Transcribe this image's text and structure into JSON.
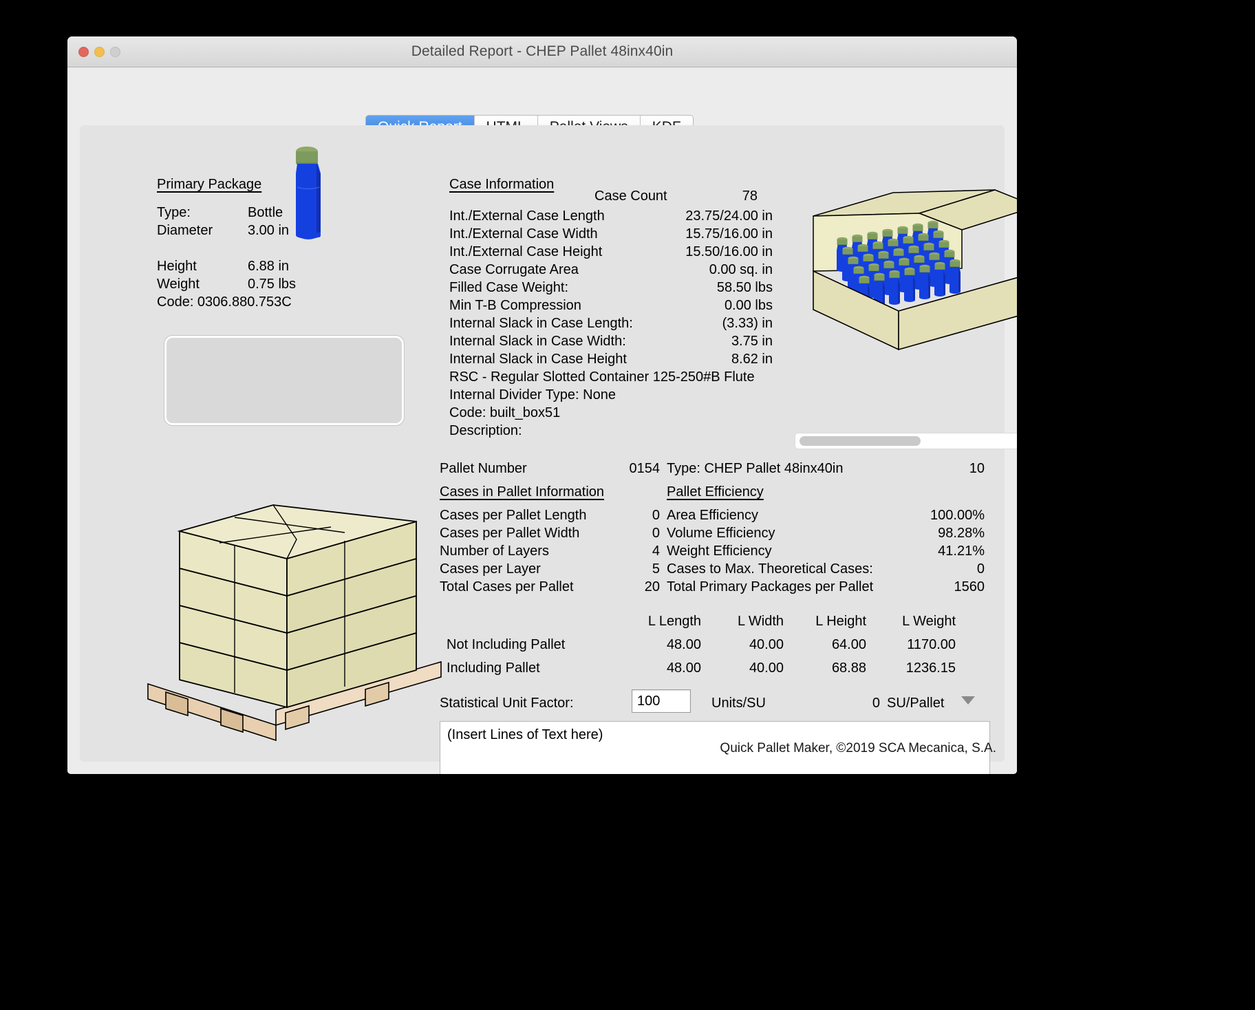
{
  "window": {
    "title": "Detailed Report - CHEP Pallet 48inx40in",
    "traffic": {
      "close": "close-button",
      "minimize": "minimize-button",
      "zoom": "zoom-button"
    }
  },
  "tabs": [
    {
      "label": "Quick Report",
      "active": true
    },
    {
      "label": "HTML",
      "active": false
    },
    {
      "label": "Pallet Views",
      "active": false
    },
    {
      "label": "KDF",
      "active": false
    }
  ],
  "primary_package": {
    "heading": "Primary Package",
    "rows": [
      {
        "label": "Type:",
        "value": "Bottle"
      },
      {
        "label": "Diameter",
        "value": "3.00 in"
      },
      {
        "label": "",
        "value": ""
      },
      {
        "label": "Height",
        "value": "6.88 in"
      },
      {
        "label": "Weight",
        "value": "0.75 lbs"
      }
    ],
    "code": "Code: 0306.880.753C"
  },
  "case_information": {
    "heading": "Case Information",
    "case_count_label": "Case Count",
    "case_count_value": "78",
    "rows": [
      {
        "label": "Int./External Case Length",
        "value": "23.75/24.00 in"
      },
      {
        "label": "Int./External Case Width",
        "value": "15.75/16.00 in"
      },
      {
        "label": "Int./External Case Height",
        "value": "15.50/16.00 in"
      },
      {
        "label": "Case Corrugate Area",
        "value": "0.00 sq. in"
      },
      {
        "label": "Filled Case Weight:",
        "value": "58.50 lbs"
      },
      {
        "label": "Min T-B Compression",
        "value": "0.00 lbs"
      },
      {
        "label": "Internal Slack in Case Length:",
        "value": "(3.33) in"
      },
      {
        "label": "Internal Slack in Case Width:",
        "value": "3.75 in"
      },
      {
        "label": "Internal Slack in Case Height",
        "value": "8.62 in"
      }
    ],
    "full_rows": [
      "RSC - Regular Slotted Container 125-250#B Flute",
      "Internal Divider Type: None",
      "Code: built_box51",
      "Description:"
    ]
  },
  "pallet": {
    "number_label": "Pallet Number",
    "number_value": "0154",
    "type_label": "Type: CHEP Pallet 48inx40in",
    "type_value": "10",
    "cases_heading": "Cases in Pallet Information",
    "efficiency_heading": "Pallet Efficiency",
    "rows": [
      {
        "left_label": "Cases per Pallet Length",
        "left_value": "0",
        "right_label": "Area Efficiency",
        "right_value": "100.00%"
      },
      {
        "left_label": "Cases per Pallet Width",
        "left_value": "0",
        "right_label": "Volume Efficiency",
        "right_value": "98.28%"
      },
      {
        "left_label": "Number of Layers",
        "left_value": "4",
        "right_label": "Weight Efficiency",
        "right_value": "41.21%"
      },
      {
        "left_label": "Cases per Layer",
        "left_value": "5",
        "right_label": "Cases to Max. Theoretical Cases:",
        "right_value": "0"
      },
      {
        "left_label": "Total Cases per Pallet",
        "left_value": "20",
        "right_label": "Total Primary Packages per Pallet",
        "right_value": "1560"
      }
    ]
  },
  "dimensions": {
    "headers": [
      "",
      "L Length",
      "L Width",
      "L Height",
      "L Weight"
    ],
    "rows": [
      {
        "label": "Not Including Pallet",
        "length": "48.00",
        "width": "40.00",
        "height": "64.00",
        "weight": "1170.00"
      },
      {
        "label": "Including Pallet",
        "length": "48.00",
        "width": "40.00",
        "height": "68.88",
        "weight": "1236.15"
      }
    ]
  },
  "statistical_unit": {
    "label": "Statistical Unit Factor:",
    "input_value": "100",
    "units_label": "Units/SU",
    "su_count": "0",
    "su_per_pallet_label": "SU/Pallet",
    "chevron": "chevron-down-icon"
  },
  "notes": {
    "placeholder_text": "(Insert Lines of Text here)"
  },
  "footer": {
    "text": "Quick Pallet Maker, ©2019 SCA Mecanica, S.A."
  },
  "colors": {
    "accent": "#2f7ce0",
    "window_bg": "#ececec",
    "panel_bg": "#e3e3e3",
    "bottle_body": "#1540e0",
    "bottle_cap": "#7d9b5e",
    "carton": "#e3e0b8"
  }
}
